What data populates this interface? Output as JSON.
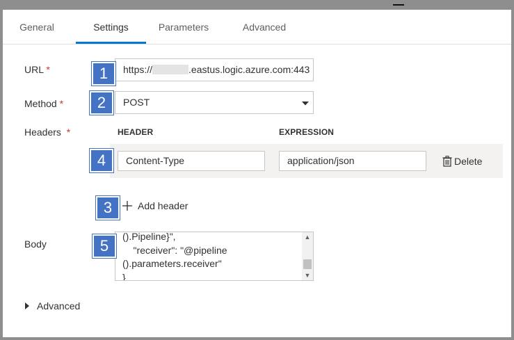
{
  "tabs": [
    {
      "label": "General"
    },
    {
      "label": "Settings"
    },
    {
      "label": "Parameters"
    },
    {
      "label": "Advanced"
    }
  ],
  "active_tab": "Settings",
  "form": {
    "url": {
      "label": "URL",
      "required": "*",
      "value_prefix": "https://",
      "value_suffix": ".eastus.logic.azure.com:443"
    },
    "method": {
      "label": "Method",
      "required": "*",
      "value": "POST"
    },
    "headers": {
      "label": "Headers",
      "required": "*",
      "col_header": "HEADER",
      "col_expression": "EXPRESSION",
      "rows": [
        {
          "header": "Content-Type",
          "expression": "application/json",
          "delete_label": "Delete"
        }
      ],
      "add_label": "Add header"
    },
    "body": {
      "label": "Body",
      "lines": [
        "().Pipeline}\",",
        "    \"receiver\": \"@pipeline",
        "().parameters.receiver\"",
        "}"
      ]
    },
    "advanced_label": "Advanced"
  },
  "badges": [
    "1",
    "2",
    "3",
    "4",
    "5"
  ],
  "colors": {
    "accent": "#0078d4",
    "badge": "#4472c4",
    "required": "#d13438"
  }
}
